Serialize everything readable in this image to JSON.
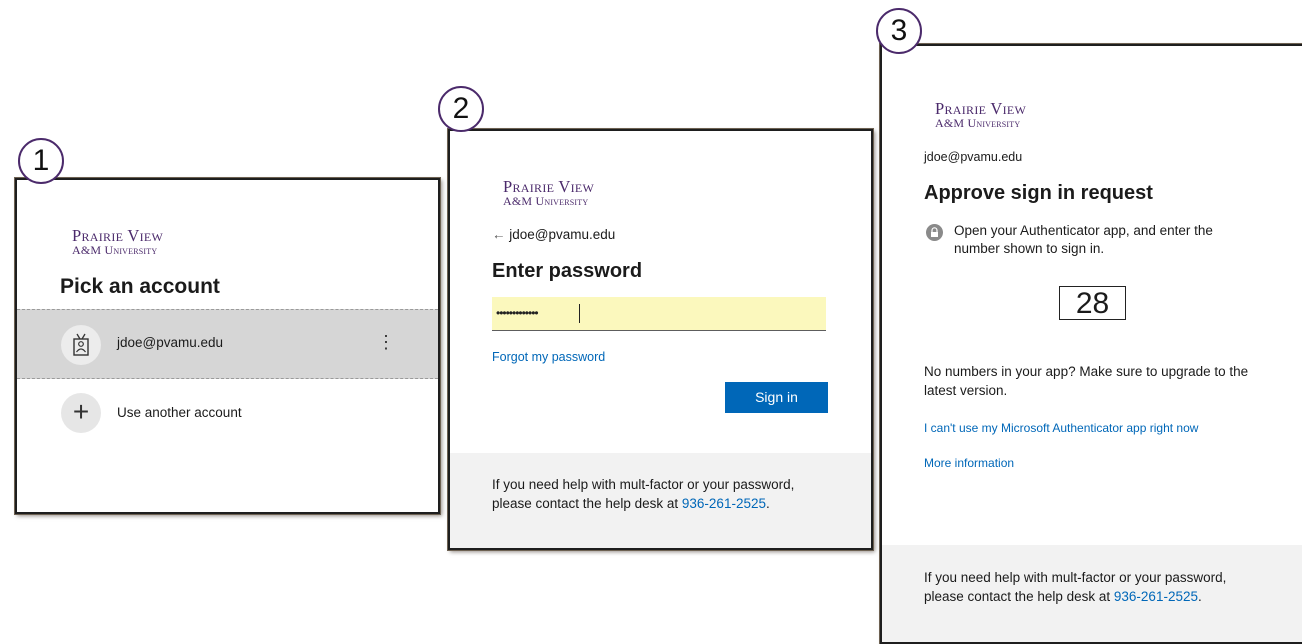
{
  "steps": [
    "1",
    "2",
    "3"
  ],
  "logo": {
    "line1": "Prairie View",
    "line2": "A&M University"
  },
  "panel1": {
    "title": "Pick an account",
    "account_email": "jdoe@pvamu.edu",
    "more_icon": "⋮",
    "add_icon": "+",
    "other_account_label": "Use another account"
  },
  "panel2": {
    "back_arrow": "←",
    "email": "jdoe@pvamu.edu",
    "title": "Enter password",
    "password_value": "•••••••••••••",
    "forgot_label": "Forgot my password",
    "signin_label": "Sign in",
    "footer_text": "If you need help with mult-factor or your password, please contact the help desk at",
    "footer_phone": "936-261-2525",
    "footer_end": "."
  },
  "panel3": {
    "email": "jdoe@pvamu.edu",
    "title": "Approve sign in request",
    "instruction": "Open your Authenticator app, and enter the number shown to sign in.",
    "number": "28",
    "no_numbers_text": "No numbers in your app? Make sure to upgrade to the latest version.",
    "cant_use_label": "I can't use my Microsoft Authenticator app right now",
    "more_info_label": "More information",
    "footer_text": "If you need help with mult-factor or your password, please contact the help desk at",
    "footer_phone": "936-261-2525",
    "footer_end": "."
  },
  "colors": {
    "brand_purple": "#4b2a6b",
    "link_blue": "#0067b8",
    "button_blue": "#0067b8",
    "input_yellow": "#fbf8bd"
  }
}
